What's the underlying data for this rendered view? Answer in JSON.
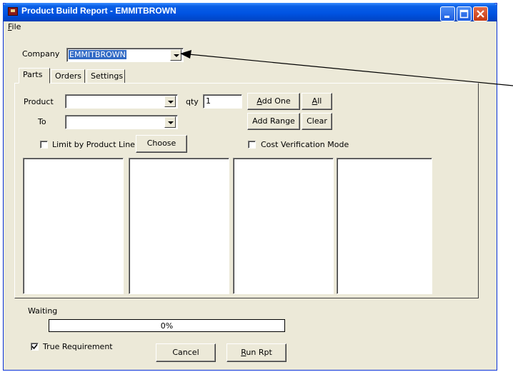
{
  "window": {
    "title": "Product Build Report - EMMITBROWN"
  },
  "menu": [
    {
      "label": "File",
      "mnemonic": "F",
      "rest": "ile"
    }
  ],
  "company": {
    "label": "Company",
    "value": "EMMITBROWN"
  },
  "tabs": [
    {
      "label": "Parts",
      "active": true
    },
    {
      "label": "Orders",
      "active": false
    },
    {
      "label": "Settings",
      "active": false
    }
  ],
  "parts": {
    "product_label": "Product",
    "product_value": "",
    "qty_label": "qty",
    "qty_value": "1",
    "to_label": "To",
    "to_value": "",
    "add_one": {
      "mnemonic": "A",
      "rest": "dd One"
    },
    "all": {
      "mnemonic": "A",
      "rest": "ll"
    },
    "add_range": "Add Range",
    "clear": "Clear",
    "limit_by_product_line": {
      "label": "Limit by Product Line",
      "checked": false
    },
    "choose": "Choose",
    "cost_verification_mode": {
      "label": "Cost Verification Mode",
      "checked": false
    }
  },
  "status": {
    "text": "Waiting",
    "progress_text": "0%",
    "progress": 0
  },
  "true_requirement": {
    "label": "True Requirement",
    "checked": true
  },
  "buttons": {
    "cancel": "Cancel",
    "run_rpt": {
      "mnemonic": "R",
      "rest": "un Rpt"
    }
  },
  "icons": [
    "app-icon",
    "minimize-icon",
    "maximize-icon",
    "close-icon",
    "chevron-down-icon",
    "arrow-annotation-icon",
    "checkmark-icon"
  ],
  "colors": {
    "titlebar": "#0054E3",
    "window_bg": "#ECE9D8",
    "selection": "#316AC5",
    "close_button": "#D54016"
  }
}
